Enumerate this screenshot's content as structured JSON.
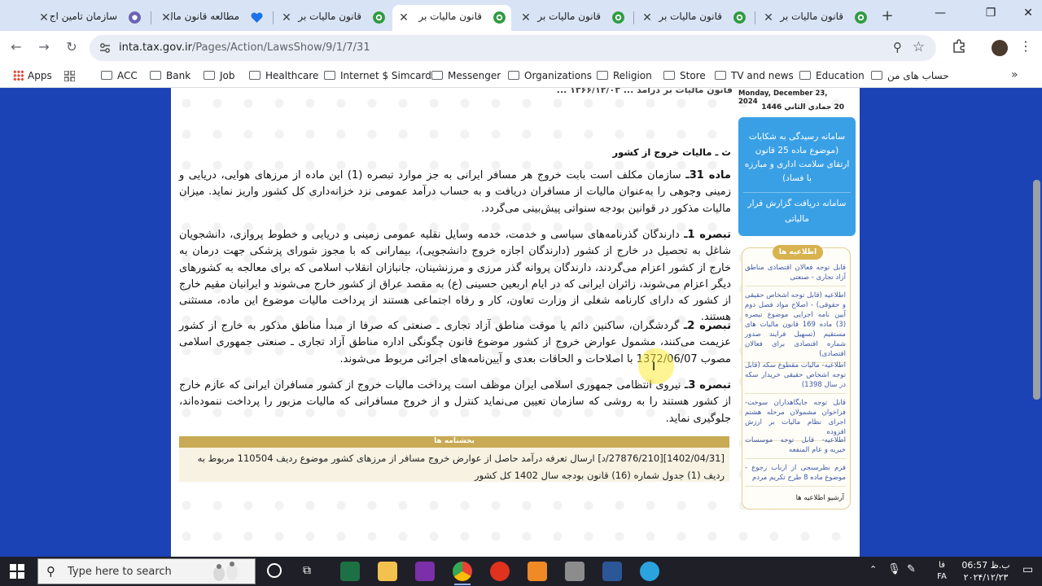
{
  "browser": {
    "tabs": [
      {
        "title": "سازمان تامین اج",
        "favicon": "ssi-logo",
        "active": false
      },
      {
        "title": "مطالعه قانون مال",
        "favicon": "heart-logo",
        "active": false
      },
      {
        "title": "قانون مالیات بر",
        "favicon": "tax-gear-logo",
        "active": false
      },
      {
        "title": "قانون مالیات بر",
        "favicon": "tax-gear-logo",
        "active": true
      },
      {
        "title": "قانون مالیات بر",
        "favicon": "tax-gear-logo",
        "active": false
      },
      {
        "title": "قانون مالیات بر",
        "favicon": "tax-gear-logo",
        "active": false
      },
      {
        "title": "قانون مالیات بر",
        "favicon": "tax-gear-logo",
        "active": false
      }
    ],
    "url_host": "inta.tax.gov.ir",
    "url_path": "/Pages/Action/LawsShow/9/1/7/31",
    "bookmarks": {
      "apps": "Apps",
      "folders": [
        "ACC",
        "Bank",
        "Job",
        "Healthcare",
        "Internet $ Simcard",
        "Messenger",
        "Organizations",
        "Religion",
        "Store",
        "TV and news",
        "Education",
        "حساب های من"
      ]
    },
    "window_controls": {
      "minimize": "—",
      "maximize": "❐",
      "close": "✕"
    }
  },
  "page": {
    "top_strip": "قانون مالیات بر درآمد ... ۱۳۶۶/۱۲/۰۳ ...",
    "section_title": "ث ـ مالیات خروج از کشور",
    "paragraphs": [
      {
        "lead": "ماده 31ـ",
        "text": " سازمان مکلف است بابت خروج هر مسافر ایرانی به جز موارد تبصره (1) این ماده از مرزهای هوایی، دریایی و زمینی وجوهی را به‌عنوان مالیات از مسافران دریافت و به حساب درآمد عمومی نزد خزانه‌داری کل کشور واریز نماید. میزان مالیات مذکور در قوانین بودجه سنواتی پیش‌بینی می‌گردد."
      },
      {
        "lead": "تبصره 1ـ",
        "text": " دارندگان گذرنامه‌های سیاسی و خدمت، خدمه وسایل نقلیه عمومی زمینی و دریایی و خطوط پروازی، دانشجویان شاغل به تحصیل در خارج از کشور (دارندگان اجازه خروج دانشجویی)، بیمارانی که با مجوز شورای پزشکی جهت درمان به خارج از کشور اعزام می‌گردند، دارندگان پروانه گذر مرزی و مرزنشینان، جانبازان انقلاب اسلامی که برای معالجه به کشورهای دیگر اعزام می‌شوند، زائران ایرانی که در ایام اربعین حسینی (ع) به مقصد عراق از کشور خارج می‌شوند و ایرانیان مقیم خارج از کشور که دارای کارنامه شغلی از وزارت تعاون، کار و رفاه اجتماعی هستند از پرداخت مالیات موضوع این ماده، مستثنی هستند."
      },
      {
        "lead": "تبصره 2ـ",
        "text": " گردشگران، ساکنین دائم یا موقت مناطق آزاد تجاری ـ صنعتی که صرفا از مبدأ مناطق مذکور به خارج از کشور عزیمت می‌کنند، مشمول عوارض خروج از کشور موضوع قانون چگونگی اداره مناطق آزاد تجاری ـ صنعتی جمهوری اسلامی مصوب 1372/06/07 با اصلاحات و الحاقات بعدی و آیین‌نامه‌های اجرائی مربوط می‌شوند."
      },
      {
        "lead": "تبصره 3ـ",
        "text": " نیروی انتظامی جمهوری اسلامی ایران موظف است پرداخت مالیات خروج از کشور مسافران ایرانی که عازم خارج از کشور هستند را به روشی که سازمان تعیین می‌نماید کنترل و از خروج مسافرانی که مالیات مزبور را پرداخت ننموده‌اند، جلوگیری نماید."
      }
    ],
    "annotation": {
      "title": "بخشنامه ها",
      "text": "[1402/04/31][27876/210/د] ارسال تعرفه درآمد حاصل از عوارض خروج مسافر از مرزهای کشور موضوع ردیف 110504 مربوط به ردیف (1) جدول شماره (16) قانون بودجه سال 1402 کل کشور"
    },
    "sidebar": {
      "date_gregorian": "Monday, December 23, 2024",
      "date_hijri": "20 جمادي الثاني 1446",
      "complaint_text": "سامانه رسیدگی به شکایات (موضوع ماده 25 قانون ارتقای سلامت اداری و مبارزه با فساد)",
      "report_text": "سامانه دریافت گزارش فرار مالیاتی",
      "notices_title": "اطلاعیه ها",
      "notices": [
        "قابل توجه فعالان اقتصادی مناطق آزاد تجاری - صنعتی",
        "اطلاعیه (قابل توجه اشخاص حقیقی و حقوقی) - اصلاح مواد فصل دوم آیین نامه اجرایی موضوع تبصره (3) ماده 169 قانون مالیات های مستقیم (تسهیل فرایند صدور شماره اقتصادی برای فعالان اقتصادی)",
        "اطلاعیه- مالیات مقطوع سکه (قابل توجه اشخاص حقیقی خریدار سکه در سال 1398)",
        "قابل توجه جایگاهداران سوخت- فراخوان مشمولان مرحله هشتم اجرای نظام مالیات بر ارزش افزوده",
        "اطلاعیه- قابل توجه موسسات خیریه و عام المنفعه",
        "فرم نظرسنجی از ارباب رجوع - موضوع ماده 8 طرح تکریم مردم"
      ],
      "archive": "آرشیو اطلاعیه ها"
    }
  },
  "taskbar": {
    "search_placeholder": "Type here to search",
    "apps": [
      "excel-icon",
      "file-explorer-icon",
      "onenote-icon",
      "chrome-icon",
      "opera-icon",
      "sticky-app-icon",
      "document-app-icon",
      "word-icon",
      "telegram-icon"
    ],
    "tray": {
      "lang_top": "فا",
      "lang_bottom": "FA",
      "time": "06:57 ب.ظ",
      "date": "۲۰۲۴/۱۲/۲۳"
    }
  }
}
